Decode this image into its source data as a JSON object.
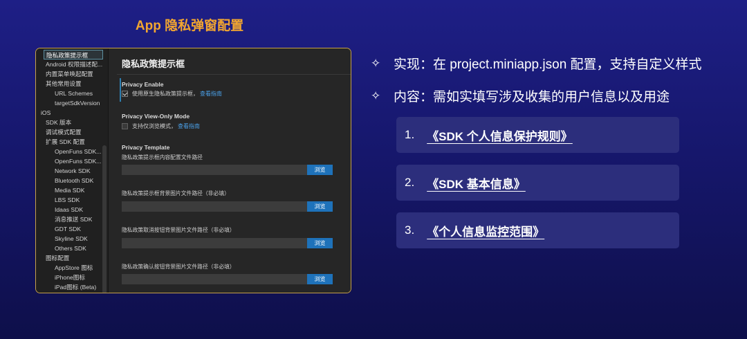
{
  "slide": {
    "title": "App 隐私弹窗配置"
  },
  "sidebar": {
    "items": [
      {
        "label": "隐私政策提示框",
        "level": 1,
        "selected": true
      },
      {
        "label": "Android 权限描述配...",
        "level": 1
      },
      {
        "label": "内置菜单唤起配置",
        "level": 1
      },
      {
        "label": "其他常用设置",
        "level": 1
      },
      {
        "label": "URL Schemes",
        "level": 2
      },
      {
        "label": "targetSdkVersion",
        "level": 2
      },
      {
        "label": "iOS",
        "level": 0
      },
      {
        "label": "SDK 版本",
        "level": 1
      },
      {
        "label": "调试模式配置",
        "level": 1
      },
      {
        "label": "扩展 SDK 配置",
        "level": 1
      },
      {
        "label": "OpenFuns SDK...",
        "level": 2
      },
      {
        "label": "OpenFuns SDK...",
        "level": 2
      },
      {
        "label": "Network SDK",
        "level": 2
      },
      {
        "label": "Bluetooth SDK",
        "level": 2
      },
      {
        "label": "Media SDK",
        "level": 2
      },
      {
        "label": "LBS SDK",
        "level": 2
      },
      {
        "label": "Idaas SDK",
        "level": 2
      },
      {
        "label": "消息推送 SDK",
        "level": 2
      },
      {
        "label": "GDT SDK",
        "level": 2
      },
      {
        "label": "Skyline SDK",
        "level": 2
      },
      {
        "label": "Others SDK",
        "level": 2
      },
      {
        "label": "图标配置",
        "level": 1
      },
      {
        "label": "AppStore 图标",
        "level": 2
      },
      {
        "label": "iPhone图标",
        "level": 2
      },
      {
        "label": "iPad图标 (Beta)",
        "level": 2
      }
    ]
  },
  "content": {
    "title": "隐私政策提示框",
    "privacy_enable": {
      "heading": "Privacy Enable",
      "checkbox_label": "使用原生隐私政策提示框，",
      "checked": true,
      "link": "查看指南"
    },
    "view_only": {
      "heading": "Privacy View-Only Mode",
      "checkbox_label": "支持仅浏览模式，",
      "checked": false,
      "link": "查看指南"
    },
    "template": {
      "heading": "Privacy Template",
      "fields": [
        {
          "label": "隐私政策提示框内容配置文件路径",
          "value": "",
          "button": "浏览"
        },
        {
          "label": "隐私政策提示框背景图片文件路径（非必填）",
          "value": "",
          "button": "浏览"
        },
        {
          "label": "隐私政策取消按钮背景图片文件路径（非必填）",
          "value": "",
          "button": "浏览"
        },
        {
          "label": "隐私政策确认按钮背景图片文件路径（非必填）",
          "value": "",
          "button": "浏览"
        }
      ]
    }
  },
  "bullets": [
    {
      "icon": "four-point-star-icon",
      "text": "实现：在 project.miniapp.json 配置，支持自定义样式"
    },
    {
      "icon": "four-point-star-icon",
      "text": "内容：需如实填写涉及收集的用户信息以及用途"
    }
  ],
  "links": [
    {
      "num": "1.",
      "text": "《SDK 个人信息保护规则》"
    },
    {
      "num": "2.",
      "text": "《SDK 基本信息》"
    },
    {
      "num": "3.",
      "text": "《个人信息监控范围》"
    }
  ],
  "colors": {
    "title_accent": "#f2a630",
    "window_border": "#c7a24a",
    "link_blue": "#4aa0e8",
    "button_blue": "#1e72ba"
  }
}
